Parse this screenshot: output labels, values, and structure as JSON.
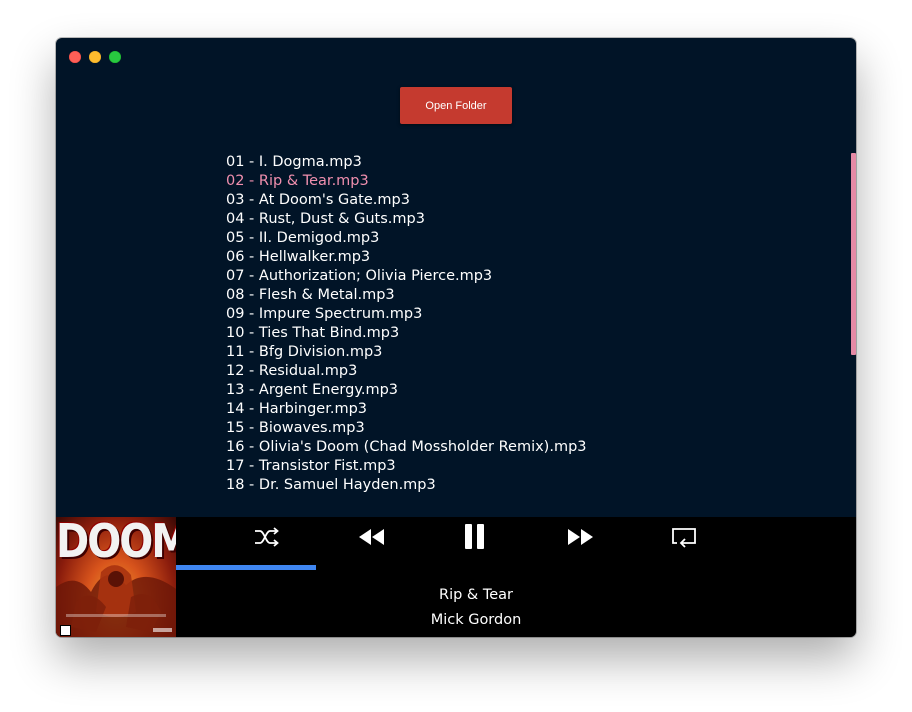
{
  "window": {
    "controls": [
      "close",
      "minimize",
      "maximize"
    ]
  },
  "toolbar": {
    "open_folder_label": "Open Folder"
  },
  "playlist": {
    "active_index": 1,
    "tracks": [
      "01 - I. Dogma.mp3",
      "02 - Rip & Tear.mp3",
      "03 - At Doom's Gate.mp3",
      "04 - Rust, Dust & Guts.mp3",
      "05 - II. Demigod.mp3",
      "06 - Hellwalker.mp3",
      "07 - Authorization; Olivia Pierce.mp3",
      "08 - Flesh & Metal.mp3",
      "09 - Impure Spectrum.mp3",
      "10 - Ties That Bind.mp3",
      "11 - Bfg Division.mp3",
      "12 - Residual.mp3",
      "13 - Argent Energy.mp3",
      "14 - Harbinger.mp3",
      "15 - Biowaves.mp3",
      "16 - Olivia's Doom (Chad Mossholder Remix).mp3",
      "17 - Transistor Fist.mp3",
      "18 - Dr. Samuel Hayden.mp3"
    ]
  },
  "player": {
    "album_art_text": "DOOM",
    "controls": [
      "shuffle-icon",
      "previous-icon",
      "pause-icon",
      "next-icon",
      "repeat-icon"
    ],
    "progress_fraction": 0.206,
    "now_playing": {
      "title": "Rip & Tear",
      "artist": "Mick Gordon"
    }
  },
  "colors": {
    "background": "#011427",
    "player_bar": "#000000",
    "accent_button": "#c53a2f",
    "active_track": "#f08fae",
    "progress": "#3f86f1",
    "scroll_thumb": "#e58aa6"
  }
}
